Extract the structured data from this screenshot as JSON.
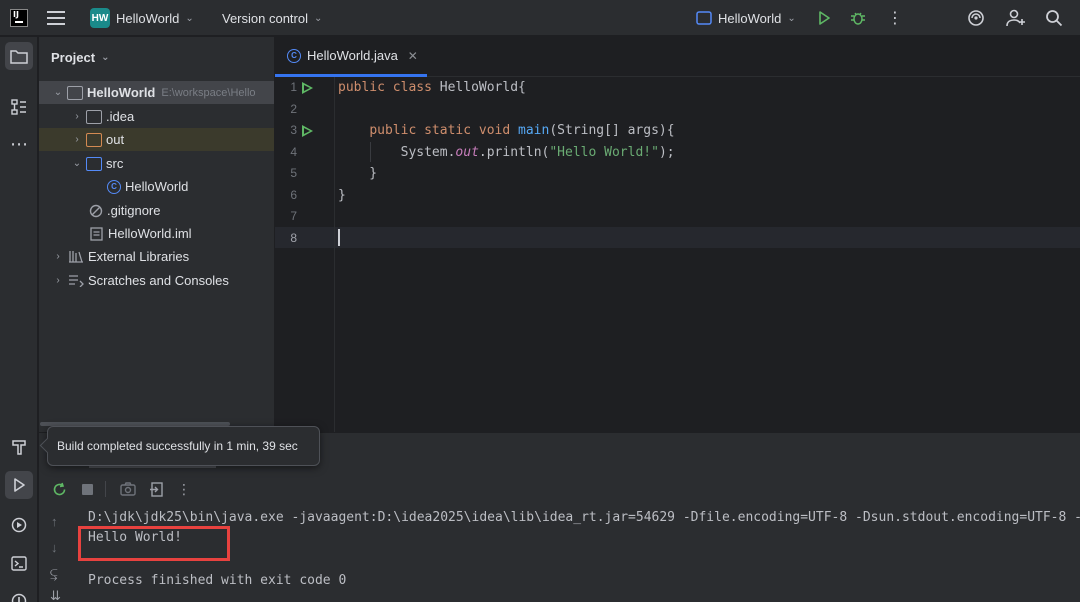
{
  "titlebar": {
    "app_logo": "intellij-logo",
    "project_badge": "HW",
    "project_name": "HelloWorld",
    "vcs_label": "Version control",
    "run_config": "HelloWorld",
    "icons": [
      "hamburger-menu-icon",
      "run-icon",
      "debug-icon",
      "more-icon",
      "ai-assistant-icon",
      "add-user-icon",
      "search-icon"
    ]
  },
  "colors": {
    "accent": "#3574f0",
    "run_green": "#5fb865",
    "error_red": "#e8423f"
  },
  "project": {
    "header": "Project",
    "tree": [
      {
        "label": "HelloWorld",
        "path": "E:\\workspace\\Hello",
        "type": "module",
        "arrow": "down",
        "level": 0,
        "selected": true
      },
      {
        "label": ".idea",
        "type": "folder",
        "arrow": "right",
        "level": 1
      },
      {
        "label": "out",
        "type": "folder-excluded",
        "arrow": "right",
        "level": 1
      },
      {
        "label": "src",
        "type": "folder-source",
        "arrow": "down",
        "level": 1
      },
      {
        "label": "HelloWorld",
        "type": "java-class",
        "level": 2
      },
      {
        "label": ".gitignore",
        "type": "ignore-file",
        "level": 1
      },
      {
        "label": "HelloWorld.iml",
        "type": "iml-file",
        "level": 1
      },
      {
        "label": "External Libraries",
        "type": "libraries",
        "arrow": "right",
        "level": 0
      },
      {
        "label": "Scratches and Consoles",
        "type": "scratches",
        "arrow": "right",
        "level": 0
      }
    ]
  },
  "editor": {
    "tab_label": "HelloWorld.java",
    "line_numbers": [
      "1",
      "2",
      "3",
      "4",
      "5",
      "6",
      "7",
      "8"
    ],
    "lines": {
      "l1": {
        "kw1": "public ",
        "kw2": "class ",
        "rest": "HelloWorld{"
      },
      "l3": {
        "indent": "    ",
        "kw": "public static void ",
        "fn": "main",
        "rest": "(String[] args){"
      },
      "l4": {
        "indent": "        ",
        "pre": "System.",
        "field": "out",
        "mid": ".println(",
        "str": "\"Hello World!\"",
        "end": ");"
      },
      "l5": {
        "text": "    }"
      },
      "l6": {
        "text": "}"
      }
    }
  },
  "tooltip": {
    "text": "Build completed successfully in 1 min, 39 sec"
  },
  "console": {
    "cmd": "D:\\jdk\\jdk25\\bin\\java.exe -javaagent:D:\\idea2025\\idea\\lib\\idea_rt.jar=54629 -Dfile.encoding=UTF-8 -Dsun.stdout.encoding=UTF-8 -",
    "output": "Hello World!",
    "exit": "Process finished with exit code 0"
  }
}
